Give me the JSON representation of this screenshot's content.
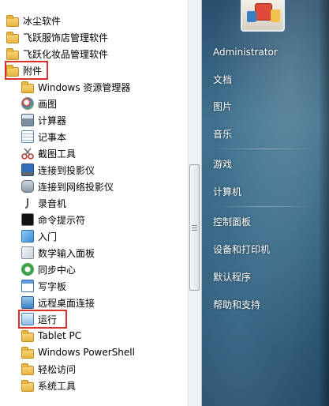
{
  "programs": [
    {
      "label": "冰尘软件",
      "icon": "folder-icon"
    },
    {
      "label": "飞跃服饰店管理软件",
      "icon": "folder-icon"
    },
    {
      "label": "飞跃化妆品管理软件",
      "icon": "folder-icon"
    },
    {
      "label": "附件",
      "icon": "folder-icon"
    },
    {
      "label": "Windows 资源管理器",
      "icon": "explorer-icon"
    },
    {
      "label": "画图",
      "icon": "paint-icon"
    },
    {
      "label": "计算器",
      "icon": "calculator-icon"
    },
    {
      "label": "记事本",
      "icon": "notepad-icon"
    },
    {
      "label": "截图工具",
      "icon": "scissors-icon"
    },
    {
      "label": "连接到投影仪",
      "icon": "projector-icon"
    },
    {
      "label": "连接到网络投影仪",
      "icon": "network-projector-icon"
    },
    {
      "label": "录音机",
      "icon": "microphone-icon"
    },
    {
      "label": "命令提示符",
      "icon": "cmd-icon"
    },
    {
      "label": "入门",
      "icon": "getting-started-icon"
    },
    {
      "label": "数学输入面板",
      "icon": "math-input-icon"
    },
    {
      "label": "同步中心",
      "icon": "sync-icon"
    },
    {
      "label": "写字板",
      "icon": "wordpad-icon"
    },
    {
      "label": "远程桌面连接",
      "icon": "remote-desktop-icon"
    },
    {
      "label": "运行",
      "icon": "run-icon"
    },
    {
      "label": "Tablet PC",
      "icon": "folder-icon"
    },
    {
      "label": "Windows PowerShell",
      "icon": "folder-icon"
    },
    {
      "label": "轻松访问",
      "icon": "folder-icon"
    },
    {
      "label": "系统工具",
      "icon": "folder-icon"
    }
  ],
  "right_menu": [
    "Administrator",
    "文档",
    "图片",
    "音乐",
    "游戏",
    "计算机",
    "控制面板",
    "设备和打印机",
    "默认程序",
    "帮助和支持"
  ],
  "colors": {
    "highlight": "#d9302b",
    "folder": "#e7b540"
  }
}
